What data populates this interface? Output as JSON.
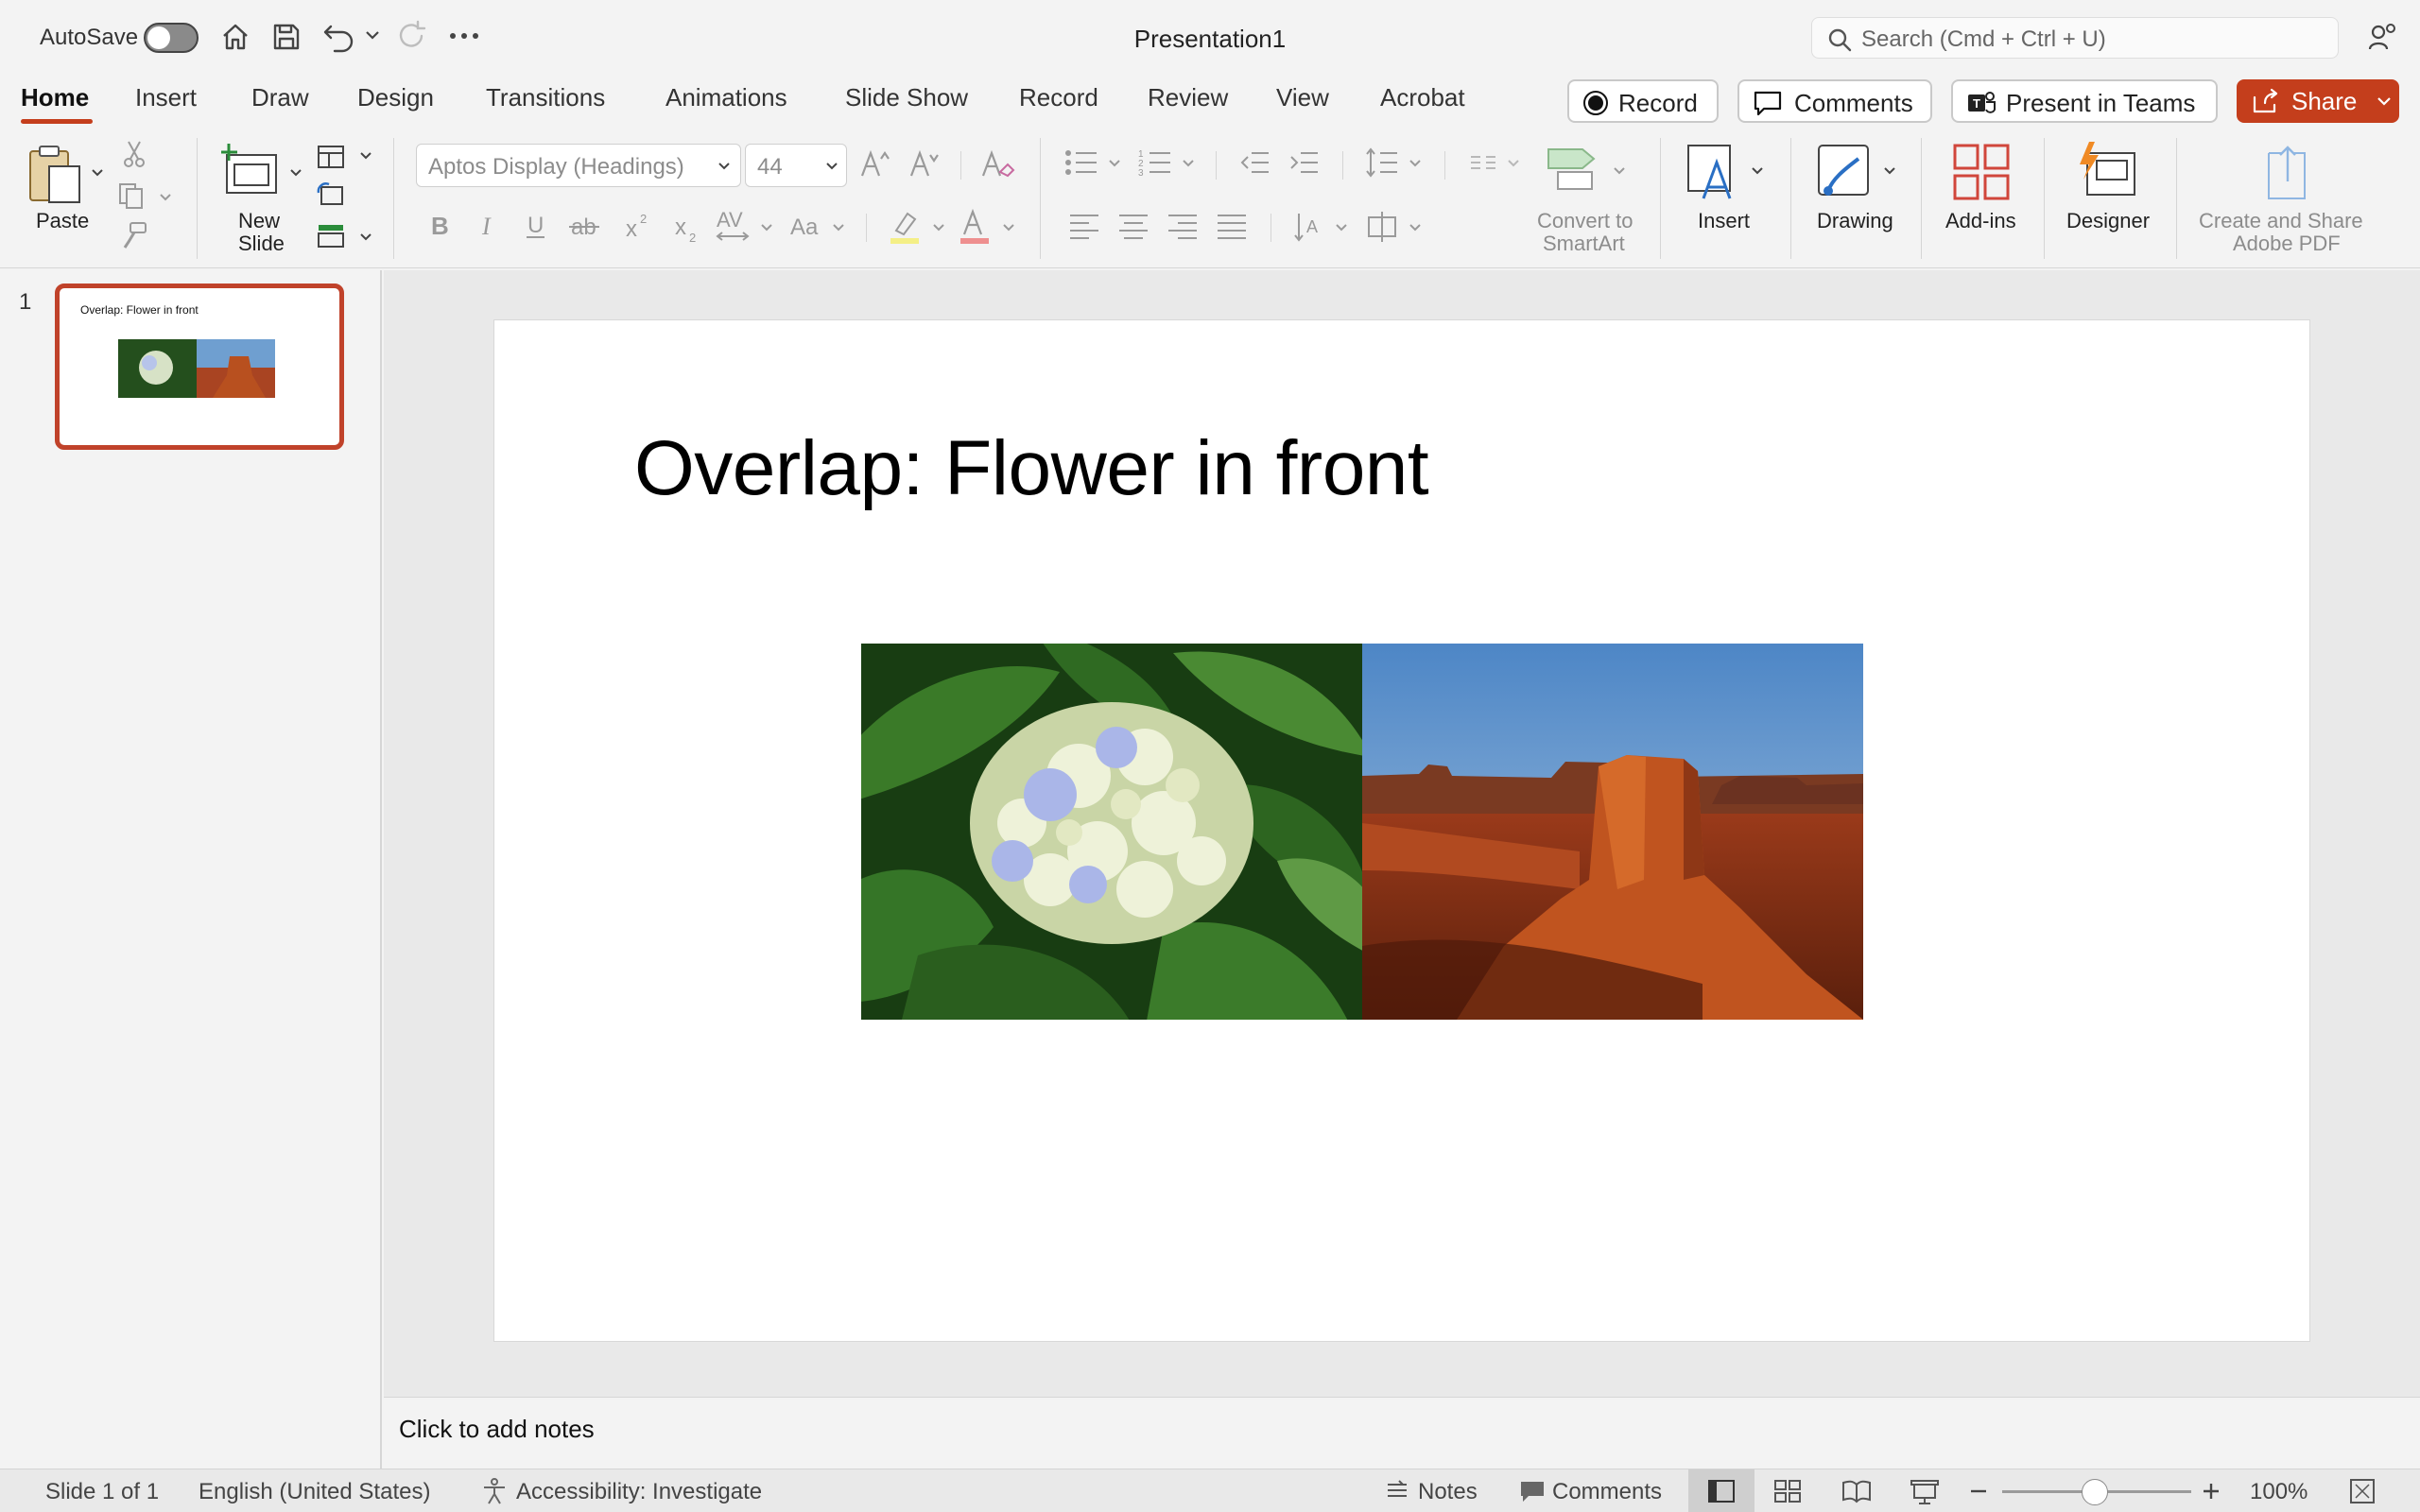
{
  "app": {
    "autosave_label": "AutoSave",
    "doc_title": "Presentation1",
    "search_placeholder": "Search (Cmd + Ctrl + U)"
  },
  "tabs": [
    "Home",
    "Insert",
    "Draw",
    "Design",
    "Transitions",
    "Animations",
    "Slide Show",
    "Record",
    "Review",
    "View",
    "Acrobat"
  ],
  "header_buttons": {
    "record": "Record",
    "comments": "Comments",
    "present": "Present in Teams",
    "share": "Share"
  },
  "ribbon": {
    "paste": "Paste",
    "new_slide_1": "New",
    "new_slide_2": "Slide",
    "font_name": "Aptos Display (Headings)",
    "font_size": "44",
    "smartart_1": "Convert to",
    "smartart_2": "SmartArt",
    "insert": "Insert",
    "drawing": "Drawing",
    "addins": "Add-ins",
    "designer": "Designer",
    "adobe_1": "Create and Share",
    "adobe_2": "Adobe PDF"
  },
  "thumbnail": {
    "number": "1",
    "title": "Overlap: Flower in front"
  },
  "slide": {
    "title": "Overlap: Flower in front"
  },
  "notes_placeholder": "Click to add notes",
  "status": {
    "slide": "Slide 1 of 1",
    "language": "English (United States)",
    "accessibility": "Accessibility: Investigate",
    "notes": "Notes",
    "comments": "Comments",
    "zoom": "100%"
  },
  "colors": {
    "accent": "#c43e1c",
    "share_bg": "#c43e1c",
    "thumb_border": "#c0422a"
  }
}
